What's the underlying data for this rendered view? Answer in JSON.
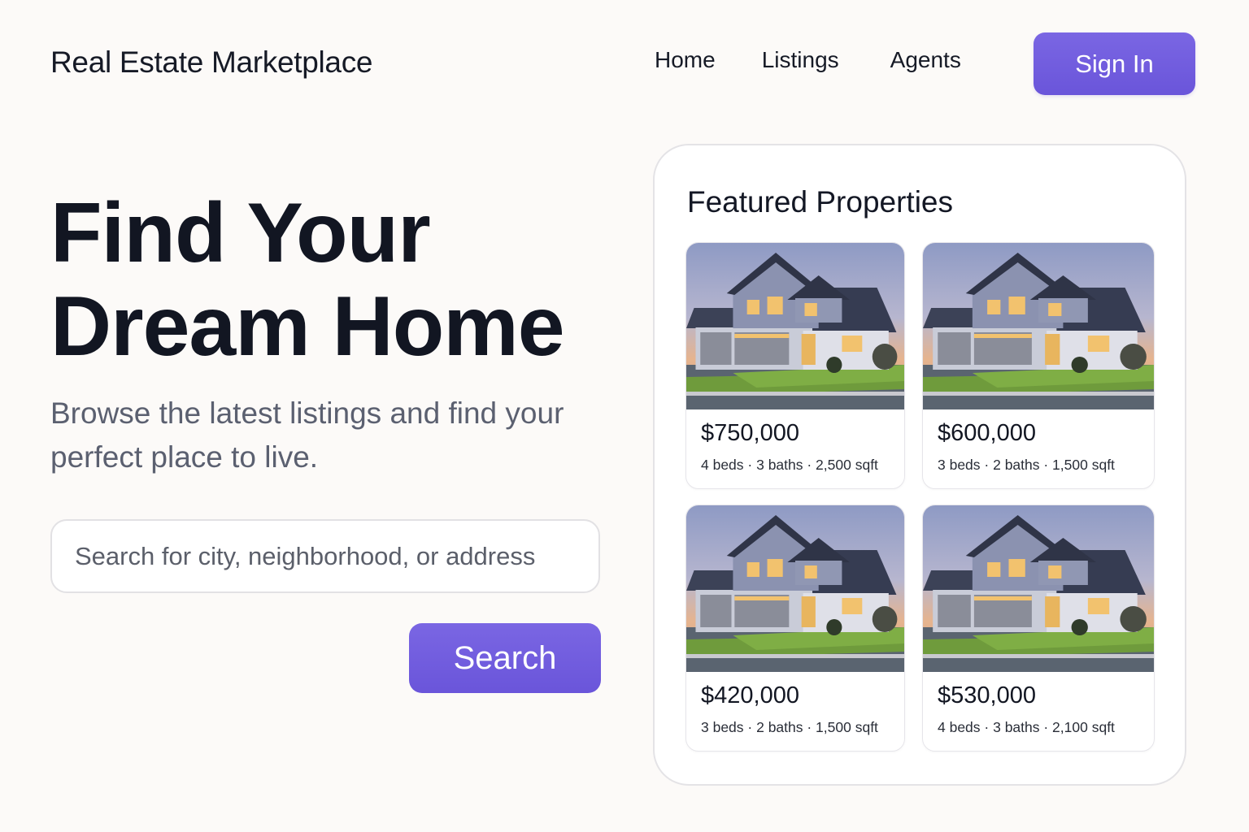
{
  "header": {
    "brand": "Real Estate Marketplace",
    "nav": [
      "Home",
      "Listings",
      "Agents"
    ],
    "sign_in": "Sign In"
  },
  "hero": {
    "title_line1": "Find Your",
    "title_line2": "Dream Home",
    "subtitle": "Browse the latest listings and find your perfect place to live.",
    "search_placeholder": "Search for city, neighborhood, or address",
    "search_button": "Search"
  },
  "featured": {
    "title": "Featured Properties",
    "listings": [
      {
        "price": "$750,000",
        "specs": "4 beds · 3 baths · 2,500 sqft"
      },
      {
        "price": "$600,000",
        "specs": "3 beds · 2 baths · 1,500 sqft"
      },
      {
        "price": "$420,000",
        "specs": "3 beds · 2 baths · 1,500 sqft"
      },
      {
        "price": "$530,000",
        "specs": "4 beds · 3 baths · 2,100 sqft"
      }
    ]
  },
  "colors": {
    "accent": "#6f5be0",
    "background": "#fcfaf8",
    "text": "#141824",
    "muted": "#5b6070"
  }
}
